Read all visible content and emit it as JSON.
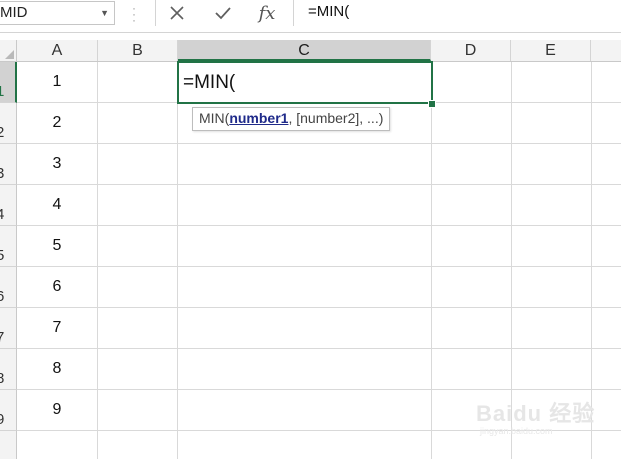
{
  "formula_bar": {
    "name_box": "MID",
    "formula_text": "=MIN(",
    "icons": [
      "cancel-icon",
      "enter-icon",
      "insert-function-icon"
    ],
    "fx_label": "fx"
  },
  "columns": [
    "A",
    "B",
    "C",
    "D",
    "E"
  ],
  "active_column": "C",
  "rows": [
    "1",
    "2",
    "3",
    "4",
    "5",
    "6",
    "7",
    "8",
    "9"
  ],
  "active_row": "1",
  "column_a_values": [
    "1",
    "2",
    "3",
    "4",
    "5",
    "6",
    "7",
    "8",
    "9"
  ],
  "active_cell": {
    "content": "=MIN("
  },
  "tooltip": {
    "func_name": "MIN(",
    "arg1": "number1",
    "rest": ", [number2], ...)"
  },
  "watermark": {
    "main": "Baidu 经验",
    "sub": "jingyan.baidu.com"
  },
  "colors": {
    "accent": "#217346",
    "header_bg": "#f3f3f3",
    "header_active_bg": "#d2d2d2",
    "tooltip_arg": "#1f2a8a"
  }
}
